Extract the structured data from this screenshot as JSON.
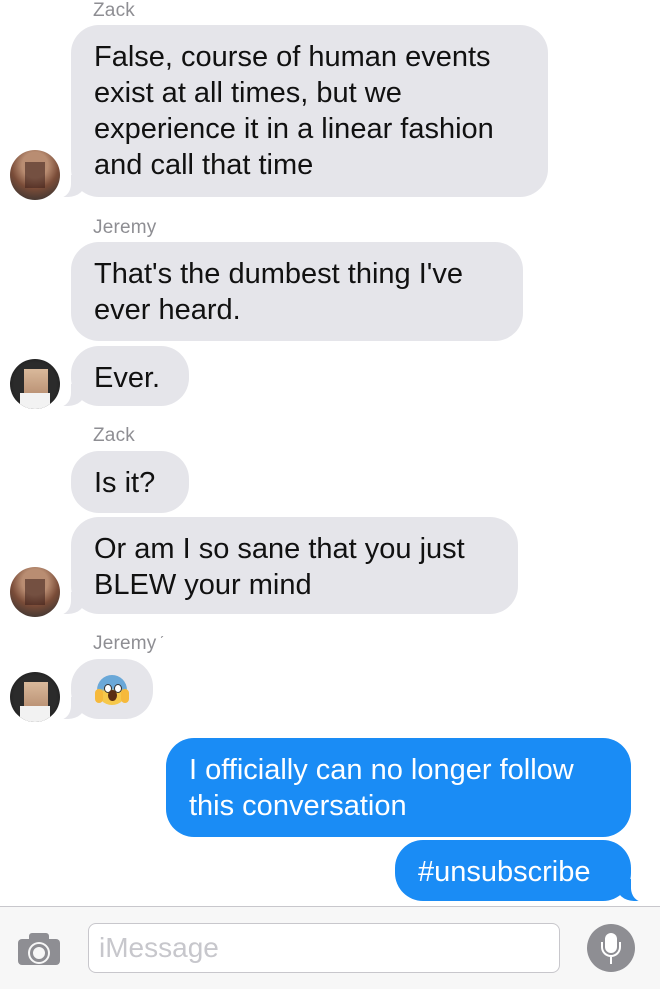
{
  "conversation": {
    "group1": {
      "sender": "Zack",
      "messages": [
        "False, course of human events exist at all times, but we experience it in a linear fashion and call that time"
      ]
    },
    "group2": {
      "sender": "Jeremy",
      "messages": [
        "That's the dumbest thing I've ever heard.",
        "Ever."
      ]
    },
    "group3": {
      "sender": "Zack",
      "messages": [
        "Is it?",
        "Or am I so sane that you just BLEW your mind"
      ]
    },
    "group4": {
      "sender": "Jeremy",
      "stray_mark": "ˊ",
      "emoji": "face-screaming-in-fear"
    },
    "outgoing": [
      "I officially can no longer follow this conversation",
      "#unsubscribe"
    ]
  },
  "input_bar": {
    "placeholder": "iMessage",
    "camera_icon": "camera-icon",
    "mic_icon": "microphone-icon"
  },
  "colors": {
    "incoming_bubble": "#e5e5ea",
    "outgoing_bubble": "#1a8cf5",
    "sender_label": "#8e8e93"
  }
}
